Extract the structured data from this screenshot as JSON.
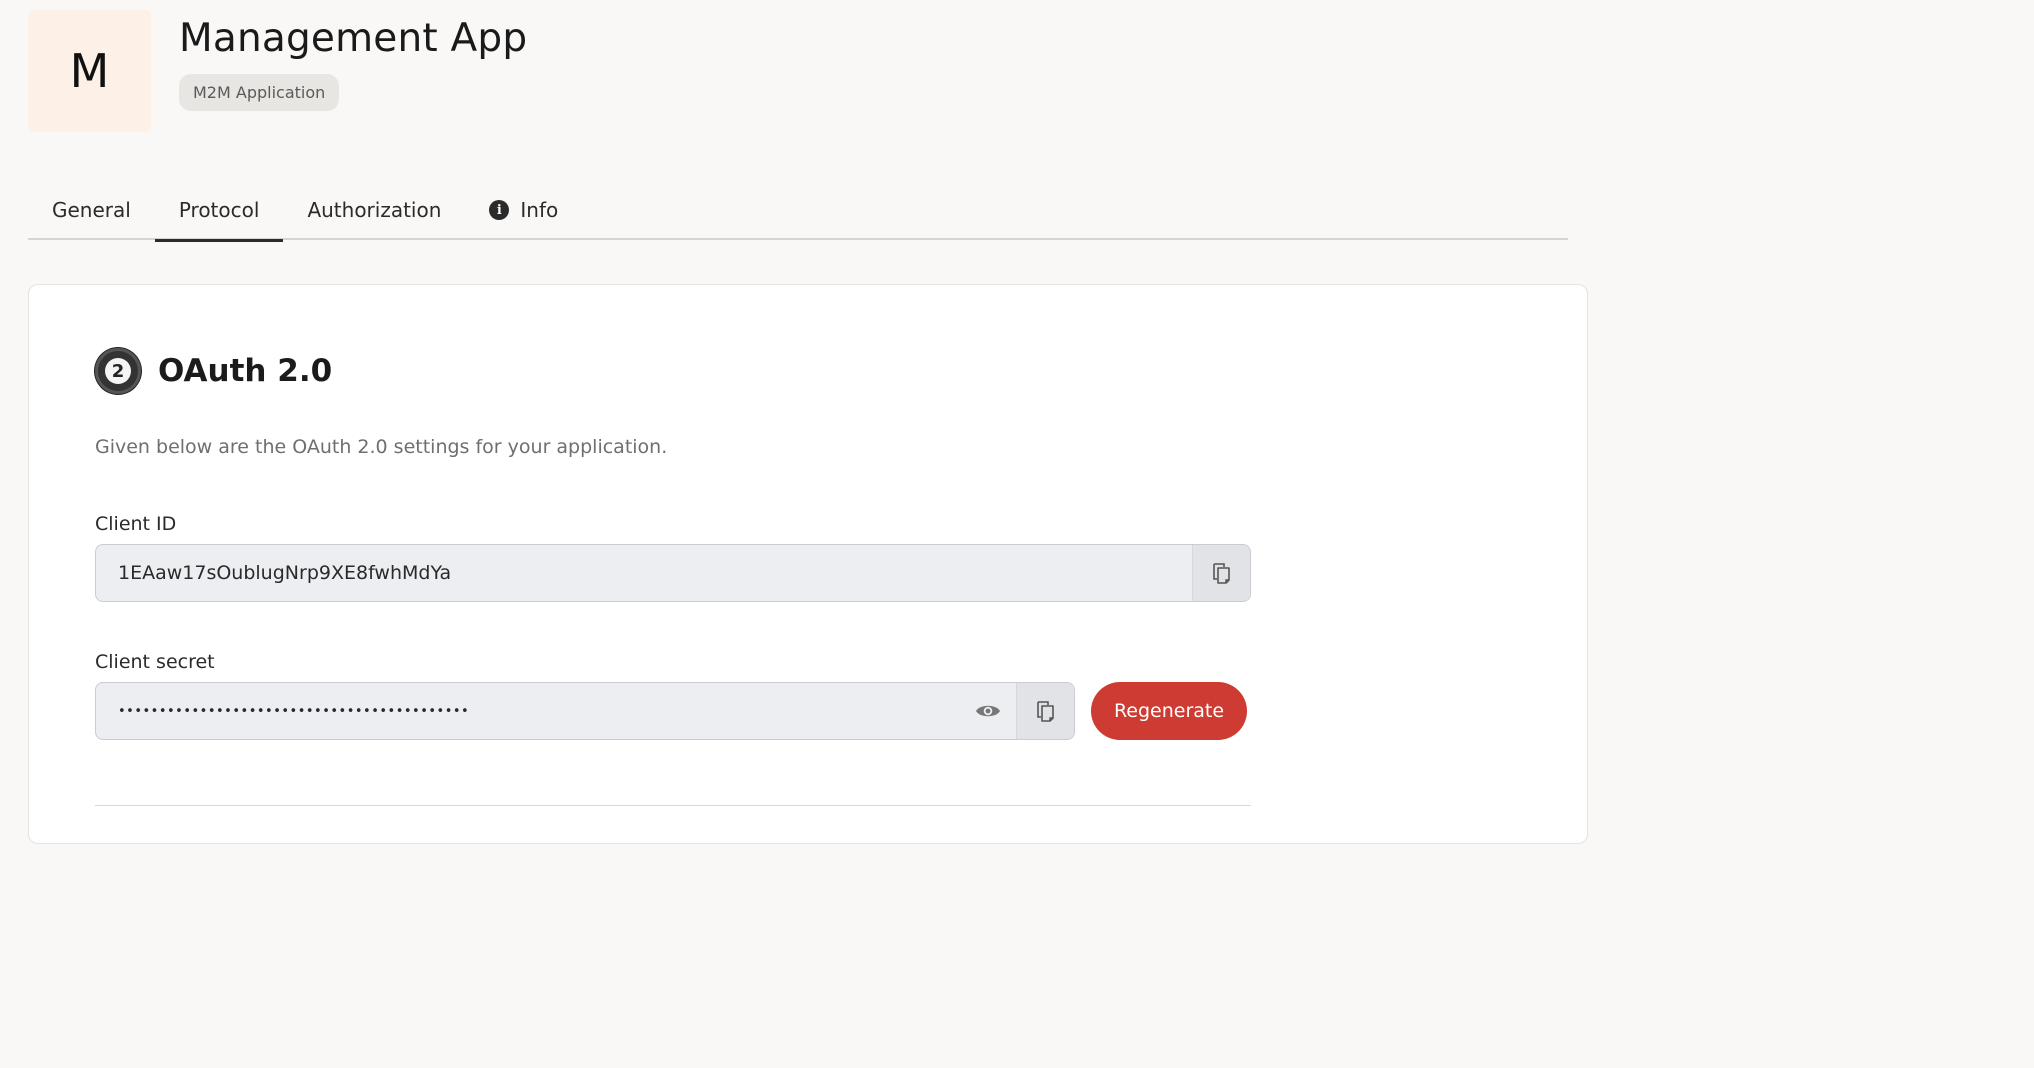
{
  "app": {
    "avatar_letter": "M",
    "title": "Management App",
    "type_badge": "M2M Application"
  },
  "tabs": [
    {
      "label": "General",
      "active": false
    },
    {
      "label": "Protocol",
      "active": true
    },
    {
      "label": "Authorization",
      "active": false
    },
    {
      "label": "Info",
      "active": false,
      "icon": "info-icon"
    }
  ],
  "oauth": {
    "title": "OAuth 2.0",
    "badge_number": "2",
    "description": "Given below are the OAuth 2.0 settings for your application.",
    "client_id": {
      "label": "Client ID",
      "value": "1EAaw17sOublugNrp9XE8fwhMdYa"
    },
    "client_secret": {
      "label": "Client secret",
      "masked_value": "•••••••••••••••••••••••••••••••••••••••••••"
    },
    "regenerate_label": "Regenerate"
  },
  "colors": {
    "accent": "#cd3b33",
    "avatar_bg": "#fdf1e7",
    "page_bg": "#f9f8f7"
  }
}
